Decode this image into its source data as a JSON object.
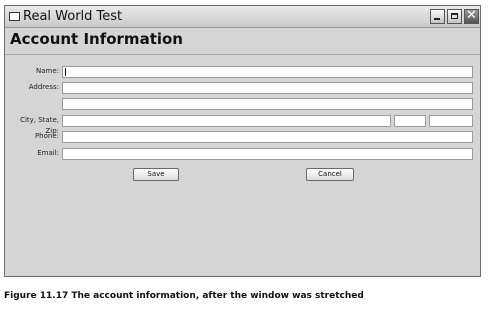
{
  "window": {
    "title": "Real World Test",
    "heading": "Account Information"
  },
  "form": {
    "name_label": "Name:",
    "name_value": "",
    "address_label": "Address:",
    "address_line1_value": "",
    "address_line2_value": "",
    "csz_label": "City, State, Zip:",
    "city_value": "",
    "state_value": "",
    "zip_value": "",
    "phone_label": "Phone:",
    "phone_value": "",
    "email_label": "Email:",
    "email_value": ""
  },
  "buttons": {
    "save_label": "Save",
    "cancel_label": "Cancel"
  },
  "caption": "Figure 11.17   The account information, after the window was stretched",
  "icons": {
    "system": "window-icon",
    "minimize": "minimize-icon",
    "maximize": "maximize-icon",
    "close": "close-icon"
  }
}
